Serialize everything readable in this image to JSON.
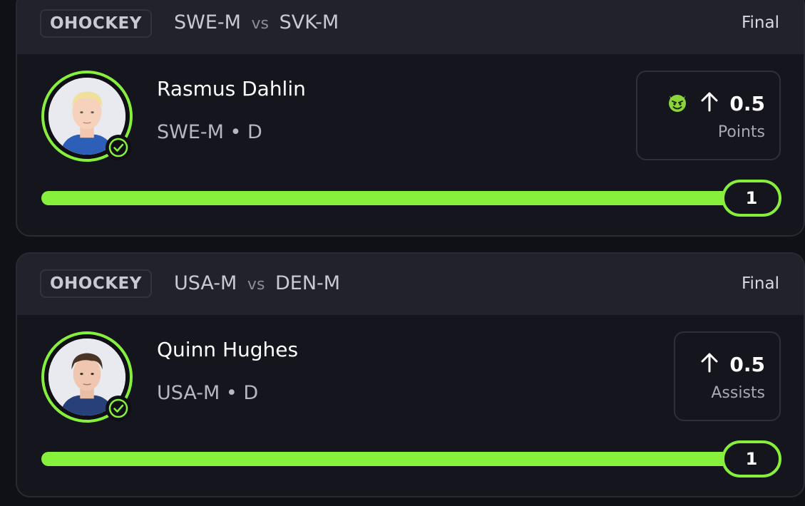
{
  "theme": {
    "accent": "#86f03c",
    "background": "#101017",
    "card": "#15151e",
    "header": "#22222c"
  },
  "cards": [
    {
      "sport": "OHOCKEY",
      "team1": "SWE-M",
      "vs": "vs",
      "team2": "SVK-M",
      "status": "Final",
      "player": {
        "name": "Rasmus Dahlin",
        "team_position": "SWE-M • D",
        "avatar_icon": "player-photo"
      },
      "pick": {
        "direction_icon": "arrow-up-icon",
        "badge_icon": "devil-emoji-icon",
        "line": "0.5",
        "stat": "Points"
      },
      "progress": {
        "result": "1",
        "fill_fraction": 1.0
      }
    },
    {
      "sport": "OHOCKEY",
      "team1": "USA-M",
      "vs": "vs",
      "team2": "DEN-M",
      "status": "Final",
      "player": {
        "name": "Quinn Hughes",
        "team_position": "USA-M • D",
        "avatar_icon": "player-photo"
      },
      "pick": {
        "direction_icon": "arrow-up-icon",
        "line": "0.5",
        "stat": "Assists"
      },
      "progress": {
        "result": "1",
        "fill_fraction": 1.0
      }
    }
  ]
}
